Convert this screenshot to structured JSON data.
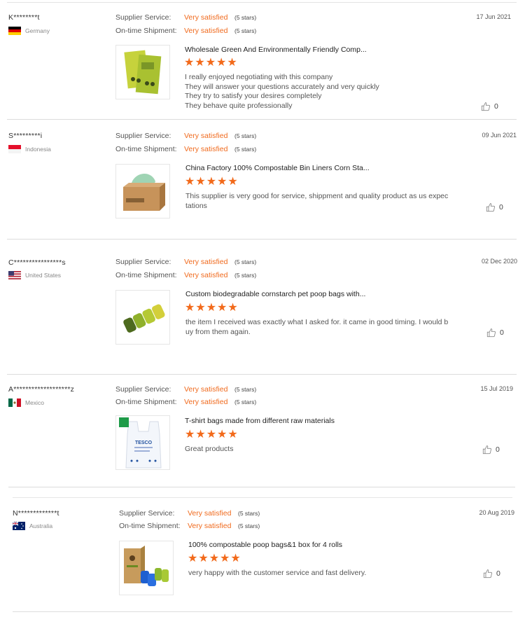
{
  "reviews": [
    {
      "buyer": "K********t",
      "country": "Germany",
      "flag": "de",
      "supplier_service_label": "Supplier Service:",
      "supplier_service_value": "Very satisfied",
      "supplier_service_stars": "(5 stars)",
      "shipment_label": "On-time Shipment:",
      "shipment_value": "Very satisfied",
      "shipment_stars": "(5 stars)",
      "date": "17 Jun 2021",
      "product_title": "Wholesale Green And Environmentally Friendly Comp...",
      "rating": 5,
      "comment_lines": [
        "I really enjoyed negotiating with this company",
        "They will answer your questions accurately and very quickly",
        "They try to satisfy your desires completely",
        "They behave quite professionally"
      ],
      "likes": "0",
      "thumb_icon": "green-bag-thumbnail"
    },
    {
      "buyer": "S*********i",
      "country": "Indonesia",
      "flag": "id",
      "supplier_service_label": "Supplier Service:",
      "supplier_service_value": "Very satisfied",
      "supplier_service_stars": "(5 stars)",
      "shipment_label": "On-time Shipment:",
      "shipment_value": "Very satisfied",
      "shipment_stars": "(5 stars)",
      "date": "09 Jun 2021",
      "product_title": "China Factory 100% Compostable Bin Liners Corn Sta...",
      "rating": 5,
      "comment_lines": [
        "This supplier is very good for service, shippment and quality product as  us expec",
        "tations"
      ],
      "likes": "0",
      "thumb_icon": "trash-bag-box-thumbnail"
    },
    {
      "buyer": "C****************s",
      "country": "United States",
      "flag": "us",
      "supplier_service_label": "Supplier Service:",
      "supplier_service_value": "Very satisfied",
      "supplier_service_stars": "(5 stars)",
      "shipment_label": "On-time Shipment:",
      "shipment_value": "Very satisfied",
      "shipment_stars": "(5 stars)",
      "date": "02 Dec 2020",
      "product_title": "Custom biodegradable cornstarch pet poop bags with...",
      "rating": 5,
      "comment_lines": [
        "the item I received was exactly what I asked for. it came in good timing. I would b",
        "uy from them again."
      ],
      "likes": "0",
      "thumb_icon": "poop-bag-rolls-thumbnail"
    },
    {
      "buyer": "A*******************z",
      "country": "Mexico",
      "flag": "mx",
      "supplier_service_label": "Supplier Service:",
      "supplier_service_value": "Very satisfied",
      "supplier_service_stars": "(5 stars)",
      "shipment_label": "On-time Shipment:",
      "shipment_value": "Very satisfied",
      "shipment_stars": "(5 stars)",
      "date": "15 Jul 2019",
      "product_title": "T-shirt bags made from different raw materials",
      "rating": 5,
      "comment_lines": [
        "Great products"
      ],
      "likes": "0",
      "thumb_icon": "tshirt-bag-thumbnail",
      "thumb_text": "TESCO"
    },
    {
      "buyer": "N*************t",
      "country": "Australia",
      "flag": "au",
      "supplier_service_label": "Supplier Service:",
      "supplier_service_value": "Very satisfied",
      "supplier_service_stars": "(5 stars)",
      "shipment_label": "On-time Shipment:",
      "shipment_value": "Very satisfied",
      "shipment_stars": "(5 stars)",
      "date": "20 Aug 2019",
      "product_title": "100% compostable poop bags&1 box for 4 rolls",
      "rating": 5,
      "comment_lines": [
        "very happy with the customer service and fast delivery."
      ],
      "likes": "0",
      "thumb_icon": "poop-bags-box-thumbnail"
    }
  ],
  "colors": {
    "accent": "#f06a1d",
    "star": "#f26a1b",
    "divider": "#dcdcdc"
  }
}
